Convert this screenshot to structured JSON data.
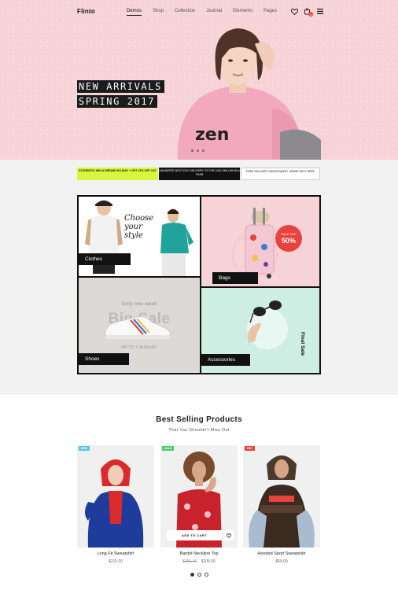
{
  "nav": {
    "logo": "Flinto",
    "links": [
      "Demos",
      "Shop",
      "Collection",
      "Journal",
      "Elements",
      "Pages"
    ],
    "icons": [
      "heart-icon",
      "cart-icon",
      "menu-icon"
    ],
    "cart_count": "0"
  },
  "hero": {
    "line1": "NEW ARRIVALS",
    "line2": "SPRING 2017",
    "bg_color": "#f6d3d6",
    "slides": 3,
    "active_slide": 1
  },
  "promos": [
    {
      "text": "STUDENTS! WIN A DREAM HOLIDAY + GET 15% OFF 24/7",
      "bg": "#d8f63e"
    },
    {
      "text": "UNLIMITED NEXT-DAY DELIVERY TO THE USA ONLY $9.95 A YEAR",
      "bg": "#111111"
    },
    {
      "text": "FREE DELIVERY WORLDWIDE* *MORE INFO HERE",
      "bg": "#ffffff"
    }
  ],
  "categories": {
    "clothes": {
      "label": "Clothes",
      "tagline_1": "Choose",
      "tagline_2": "your",
      "tagline_3": "style"
    },
    "bags": {
      "label": "Bags",
      "sale_off": "SALE OFF",
      "sale_pct": "50%"
    },
    "shoes": {
      "label": "Shoes",
      "top_text": "Only one week",
      "big_text": "Big Sale",
      "bottom_text": "UP TO 7 AUGUST"
    },
    "accessories": {
      "label": "Accessories",
      "side_text": "Final Sale"
    }
  },
  "products_section": {
    "title": "Best Selling Products",
    "subtitle": "That You Shouldn't Miss Out",
    "items": [
      {
        "badge": "NEW",
        "badge_color": "#52c6e8",
        "name": "Long Fit Sweatshirt",
        "price": "$215.00",
        "old_price": ""
      },
      {
        "badge": "SALE",
        "badge_color": "#4ccb6a",
        "name": "Bardot Neckline Top",
        "price": "$109.00",
        "old_price": "$350.00"
      },
      {
        "badge": "HOT",
        "badge_color": "#e8423f",
        "name": "Hooded Sport Sweatshirt",
        "price": "$69.00",
        "old_price": ""
      }
    ],
    "add_to_cart": "ADD TO CART",
    "pages": 3,
    "active_page": 1
  }
}
